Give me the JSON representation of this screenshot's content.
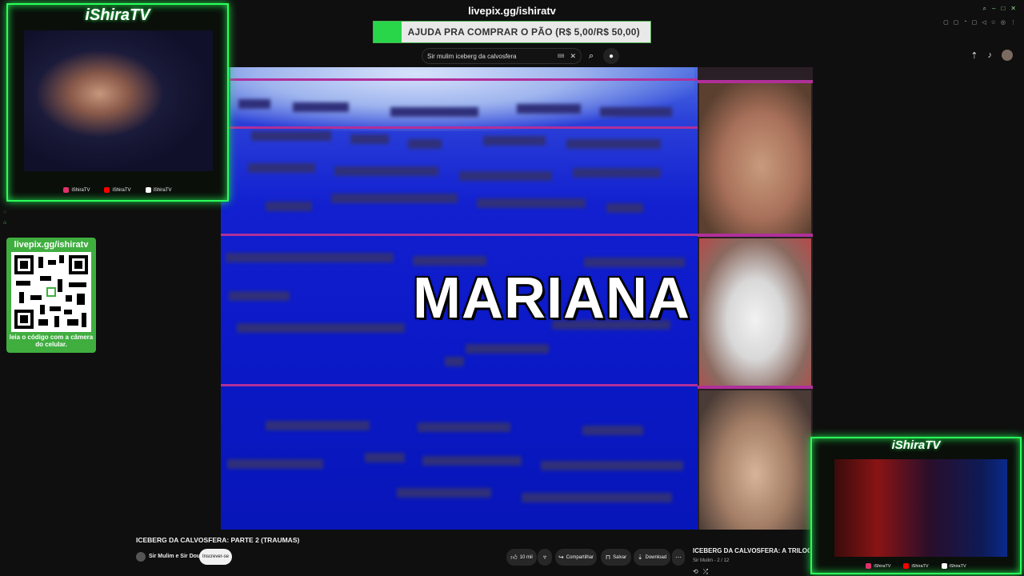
{
  "overlay": {
    "channel_title": "iShiraTV",
    "pix_url": "livepix.gg/ishiratv",
    "donation_goal": "AJUDA PRA COMPRAR O PÃO (R$ 5,00/R$ 50,00)",
    "donation_progress": 0.1,
    "qr_url": "livepix.gg/ishiratv",
    "qr_note": "leia o código com a câmera do celular.",
    "socials": [
      {
        "label": "iShiraTV",
        "icon": "instagram-icon",
        "color": "#e1306c"
      },
      {
        "label": "iShiraTV",
        "icon": "youtube-icon",
        "color": "#ff0000"
      },
      {
        "label": "iShiraTV",
        "icon": "tiktok-icon",
        "color": "#ffffff"
      }
    ],
    "accent": "#2bff5a"
  },
  "youtube": {
    "search_query": "Sir mulim iceberg da calvosfera",
    "video": {
      "overlay_word": "MARIANA",
      "title": "ICEBERG DA CALVOSFERA: PARTE 2 (TRAUMAS)",
      "channel": "Sir Mulim e Sir Doux",
      "subscribe_label": "Inscrever-se",
      "likes": "10 mil",
      "share_label": "Compartilhar",
      "save_label": "Salvar",
      "download_label": "Download"
    },
    "playlist": {
      "title": "ICEBERG DA CALVOSFERA: A TRILOGIA (e I",
      "subtitle": "Sir Mulim - 2 / 12"
    }
  }
}
